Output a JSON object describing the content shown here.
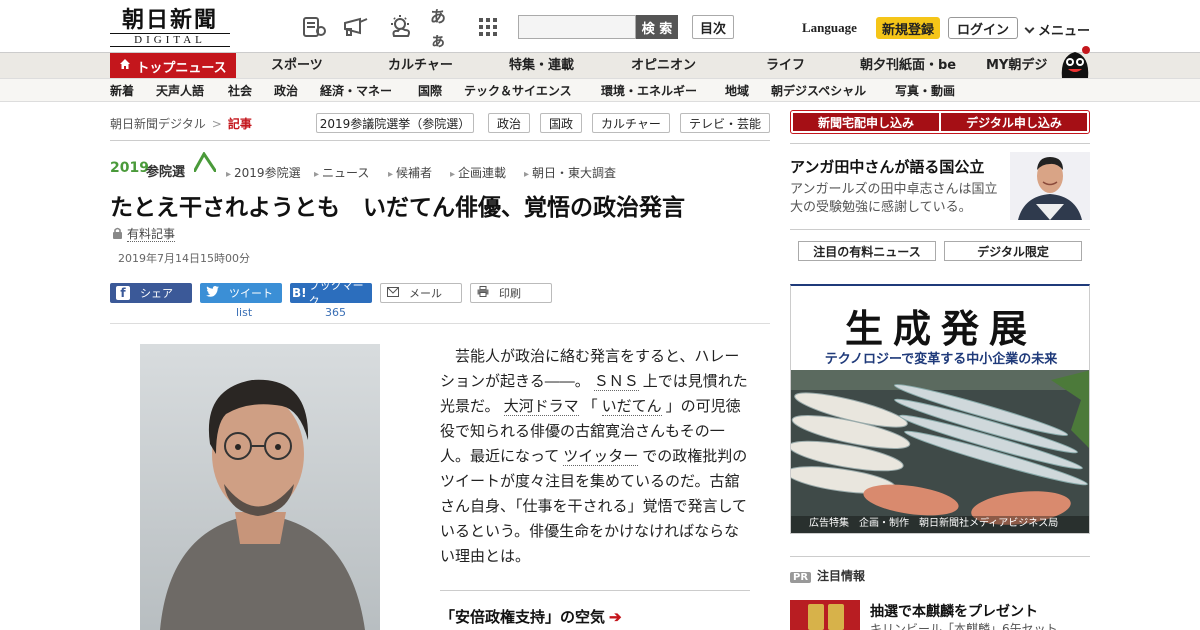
{
  "header": {
    "logo_top": "朝日新聞",
    "logo_bottom": "DIGITAL",
    "icons": [
      "newspaper-icon",
      "megaphone-icon",
      "weather-icon",
      "font-size-icon",
      "apps-grid-icon"
    ],
    "font_size_label": "あぁ",
    "search_placeholder": "",
    "search_button": "検 索",
    "mokuji": "目次",
    "language": "Language",
    "register": "新規登録",
    "login": "ログイン",
    "menu": "メニュー"
  },
  "nav1": {
    "top_news": "トップニュース",
    "items": [
      "スポーツ",
      "カルチャー",
      "特集・連載",
      "オピニオン",
      "ライフ",
      "朝夕刊紙面・be",
      "MY朝デジ"
    ]
  },
  "nav2": {
    "items": [
      "新着",
      "天声人語",
      "社会",
      "政治",
      "経済・マネー",
      "国際",
      "テック＆サイエンス",
      "環境・エネルギー",
      "地域",
      "朝デジスペシャル",
      "写真・動画"
    ]
  },
  "breadcrumb": {
    "root": "朝日新聞デジタル",
    "separator": ">",
    "current": "記事"
  },
  "tags": [
    "2019参議院選挙（参院選）",
    "政治",
    "国政",
    "カルチャー",
    "テレビ・芸能"
  ],
  "series": {
    "logo_year": "2019",
    "logo_label": "参院選",
    "links": [
      "2019参院選",
      "ニュース",
      "候補者",
      "企画連載",
      "朝日・東大調査"
    ]
  },
  "article": {
    "title": "たとえ干されようとも　いだてん俳優、覚悟の政治発言",
    "paid_label": "有料記事",
    "date": "2019年7月14日15時00分",
    "body": [
      {
        "t": "芸能人が政治に絡む発言をすると、ハレーションが起きる――。",
        "link": false
      },
      {
        "t": "ＳＮＳ",
        "link": true
      },
      {
        "t": "上では見慣れた光景だ。",
        "link": false
      },
      {
        "t": "大河ドラマ",
        "link": true
      },
      {
        "t": "「",
        "link": false
      },
      {
        "t": "いだてん",
        "link": true
      },
      {
        "t": "」の可児徳役で知られる俳優の古舘寛治さんもその一人。最近になって",
        "link": false
      },
      {
        "t": "ツイッター",
        "link": true
      },
      {
        "t": "での政権批判のツイートが度々注目を集めているのだ。古舘さん自身、「仕事を干される」覚悟で発言しているという。俳優生命をかけなければならない理由とは。",
        "link": false
      }
    ],
    "subhead": "「安倍政権支持」の空気"
  },
  "share": {
    "facebook": "シェア",
    "twitter": "ツイート",
    "twitter_sub": "list",
    "hatena": "ブックマーク",
    "hatena_icon": "B!",
    "hatena_count": "365",
    "mail": "メール",
    "print": "印刷"
  },
  "sidebar": {
    "subscribe_paper": "新聞宅配申し込み",
    "subscribe_digital": "デジタル申し込み",
    "feature_title": "アンガ田中さんが語る国公立",
    "feature_desc": "アンガールズの田中卓志さんは国立大の受験勉強に感謝している。",
    "tab_paid": "注目の有料ニュース",
    "tab_digital": "デジタル限定",
    "ad_title": "生成発展",
    "ad_subtitle": "テクノロジーで変革する中小企業の未来",
    "ad_credit": "広告特集　企画・制作　朝日新聞社メディアビジネス局",
    "pr_badge": "PR",
    "pr_heading": "注目情報",
    "pr_title": "抽選で本麒麟をプレゼント",
    "pr_desc": "キリンビール「本麒麟」6缶セット"
  },
  "colors": {
    "brand_red": "#c4161c",
    "nav_bg": "#ebe9e4",
    "facebook": "#3b5998",
    "twitter": "#3b8fd6",
    "hatena": "#2c6ebd",
    "ad_blue": "#1f3a7a",
    "highlight_yellow": "#f5c518"
  }
}
